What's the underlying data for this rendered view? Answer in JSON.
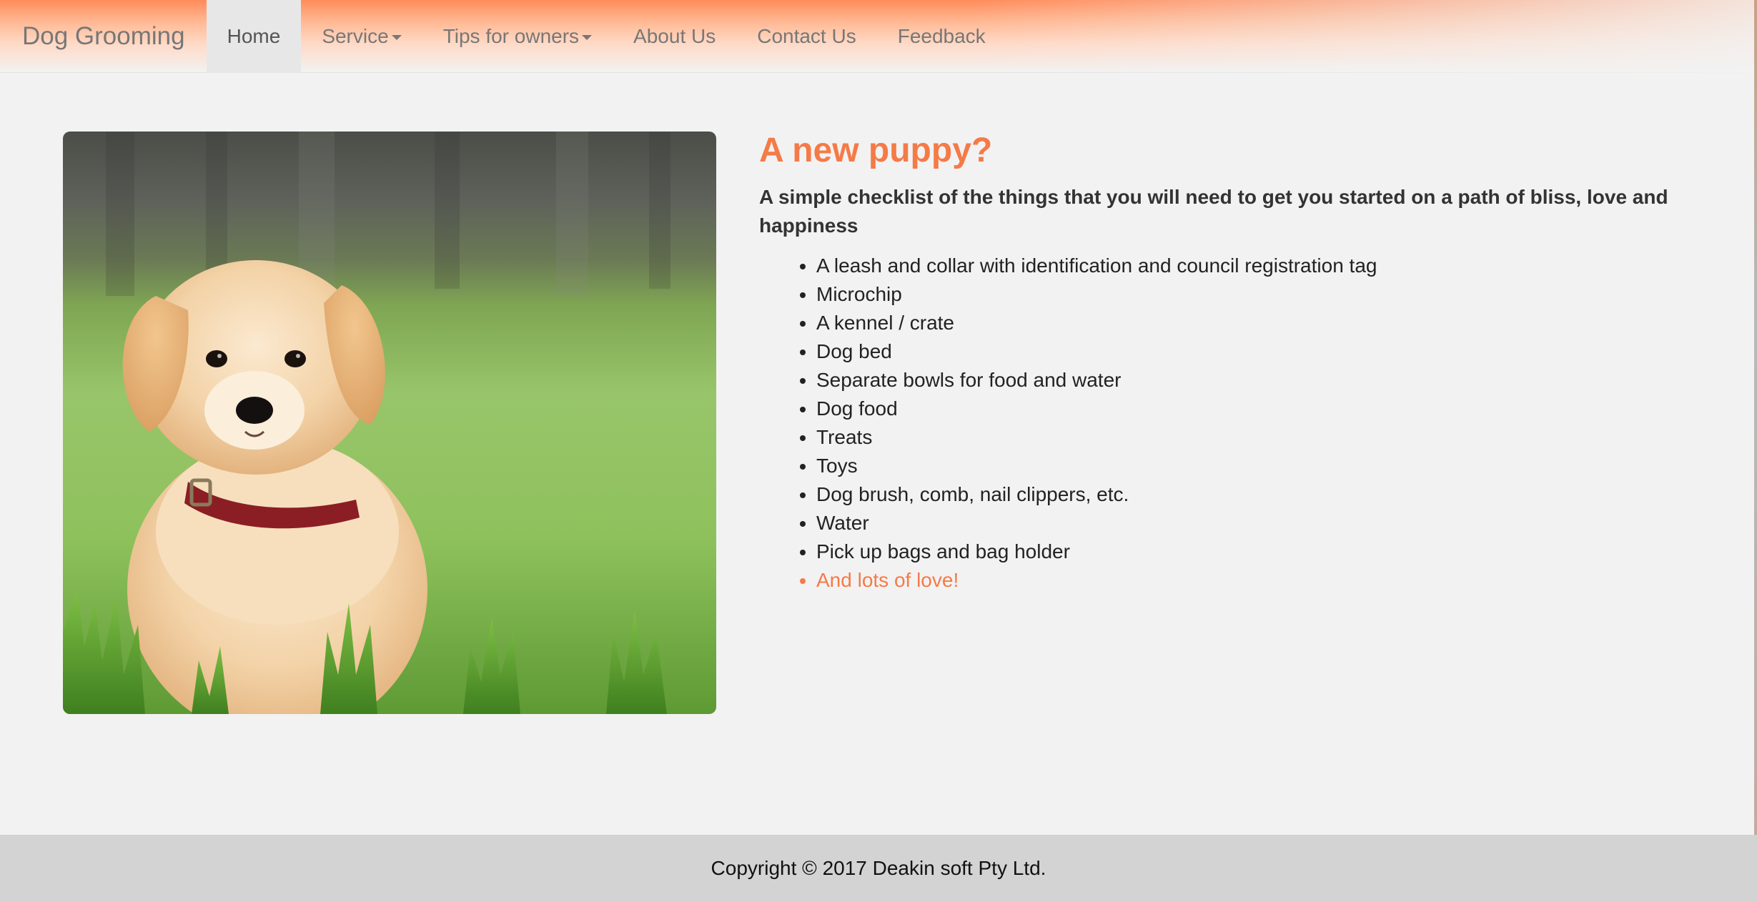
{
  "navbar": {
    "brand": "Dog Grooming",
    "items": [
      {
        "label": "Home",
        "active": true,
        "dropdown": false
      },
      {
        "label": "Service",
        "active": false,
        "dropdown": true
      },
      {
        "label": "Tips for owners",
        "active": false,
        "dropdown": true
      },
      {
        "label": "About Us",
        "active": false,
        "dropdown": false
      },
      {
        "label": "Contact Us",
        "active": false,
        "dropdown": false
      },
      {
        "label": "Feedback",
        "active": false,
        "dropdown": false
      }
    ]
  },
  "main": {
    "title": "A new puppy?",
    "subtitle": "A simple checklist of the things that you will need to get you started on a path of bliss, love and happiness",
    "checklist": [
      "A leash and collar with identification and council registration tag",
      "Microchip",
      "A kennel / crate",
      "Dog bed",
      "Separate bowls for food and water",
      "Dog food",
      "Treats",
      "Toys",
      "Dog brush, comb, nail clippers, etc.",
      "Water",
      "Pick up bags and bag holder",
      "And lots of love!"
    ]
  },
  "footer": {
    "text": "Copyright © 2017 Deakin soft Pty Ltd."
  },
  "colors": {
    "accent": "#f47b47",
    "navbar_gradient_start": "#ff8c5a",
    "page_background": "#f2f2f2",
    "footer_background": "#d3d3d3"
  },
  "icons": {
    "dropdown": "caret-down-icon"
  }
}
